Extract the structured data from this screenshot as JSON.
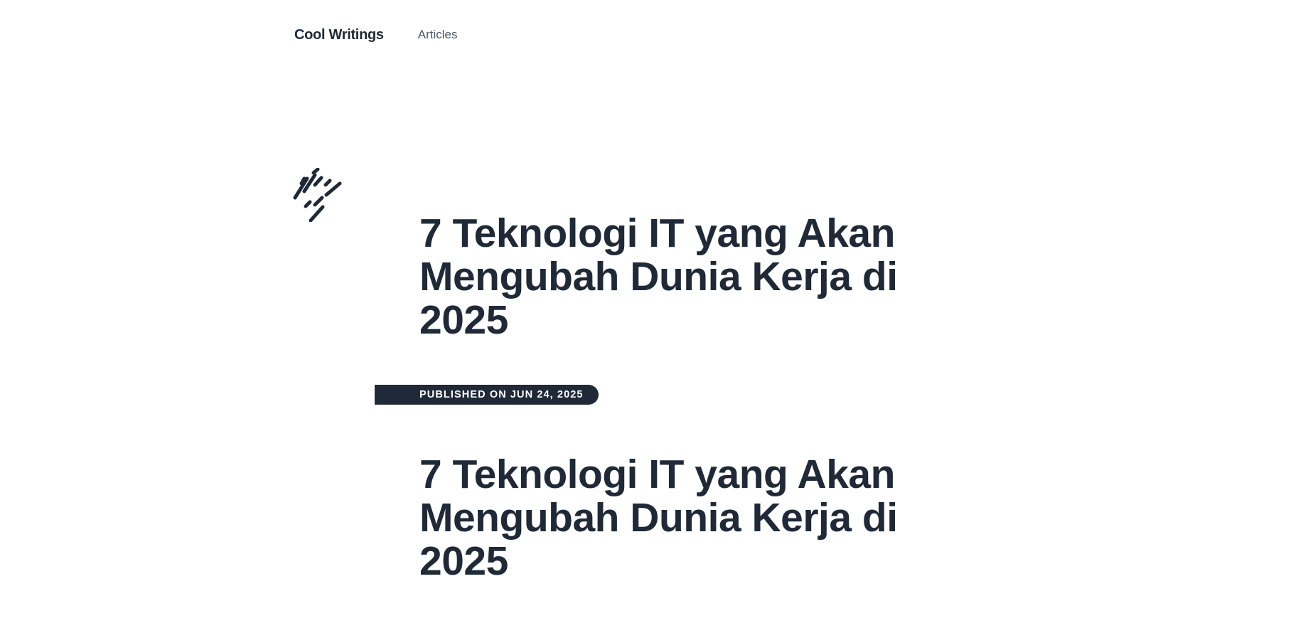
{
  "header": {
    "brand": "Cool Writings",
    "nav": [
      {
        "label": "Articles"
      }
    ]
  },
  "article": {
    "title": "7 Teknologi IT yang Akan Mengubah Dunia Kerja di 2025",
    "published": "PUBLISHED ON JUN 24, 2025",
    "body_title": "7 Teknologi IT yang Akan Mengubah Dunia Kerja di 2025"
  },
  "colors": {
    "text": "#1f2937",
    "nav_link": "#4b5563",
    "badge_bg": "#1f2937",
    "badge_text": "#ffffff"
  },
  "icons": {
    "decoration": "scribble-icon"
  }
}
